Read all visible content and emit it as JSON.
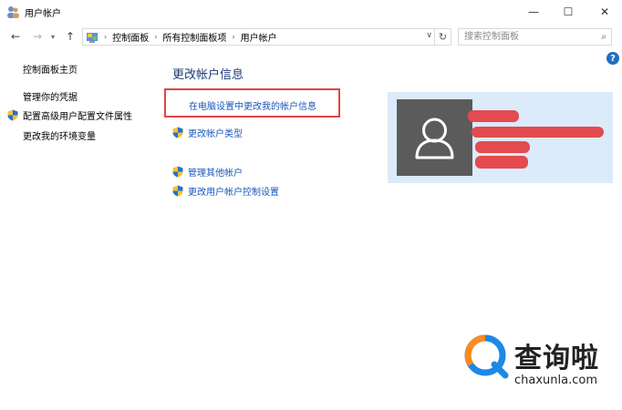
{
  "window": {
    "title": "用户帐户",
    "min_label": "—",
    "max_label": "☐",
    "close_label": "✕"
  },
  "nav": {
    "back": "←",
    "forward": "→",
    "recent": "▾",
    "up": "↑",
    "refresh": "↻",
    "dropdown": "∨"
  },
  "address": {
    "breadcrumbs": [
      "控制面板",
      "所有控制面板项",
      "用户帐户"
    ],
    "separator": "›"
  },
  "search": {
    "placeholder": "搜索控制面板",
    "icon": "⌕"
  },
  "help": {
    "label": "?"
  },
  "sidebar": {
    "items": [
      {
        "label": "控制面板主页",
        "icon": ""
      },
      {
        "label": "管理你的凭据",
        "icon": ""
      },
      {
        "label": "配置高级用户配置文件属性",
        "icon": "shield-icon"
      },
      {
        "label": "更改我的环境变量",
        "icon": ""
      }
    ]
  },
  "main": {
    "title": "更改帐户信息",
    "links": [
      {
        "label": "在电脑设置中更改我的帐户信息",
        "icon": ""
      },
      {
        "label": "更改帐户类型",
        "icon": "shield-icon"
      },
      {
        "label": "管理其他帐户",
        "icon": "shield-icon"
      },
      {
        "label": "更改用户帐户控制设置",
        "icon": "shield-icon"
      }
    ]
  },
  "colors": {
    "link": "#1a57b8",
    "title": "#1e3a78",
    "highlight": "#e04545",
    "panel": "#dcebfa",
    "avatar": "#5b5b5b",
    "redaction": "#e34b4f",
    "brand_blue": "#1e88e5",
    "brand_orange": "#ff8a1e"
  },
  "watermark": {
    "name": "查询啦",
    "url": "chaxunla.com"
  }
}
